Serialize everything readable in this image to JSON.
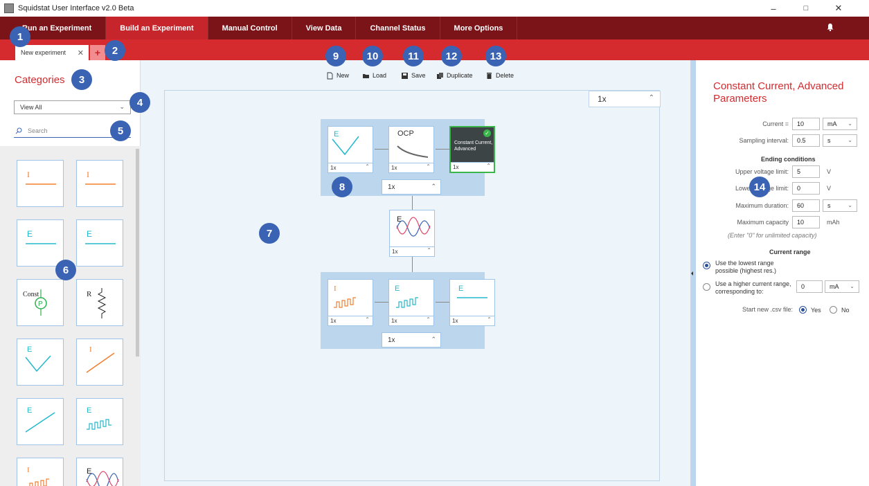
{
  "window": {
    "title": "Squidstat User Interface v2.0 Beta",
    "controls": [
      "–",
      "□",
      "✕"
    ]
  },
  "nav": {
    "tabs": [
      {
        "label": "Run an Experiment",
        "active": false
      },
      {
        "label": "Build an Experiment",
        "active": true
      },
      {
        "label": "Manual Control",
        "active": false
      },
      {
        "label": "View Data",
        "active": false
      },
      {
        "label": "Channel Status",
        "active": false
      },
      {
        "label": "More Options",
        "active": false
      }
    ],
    "bell_icon": "bell-icon"
  },
  "experiment_tabs": {
    "current": "New experiment",
    "close": "✕",
    "add": "+"
  },
  "callouts": [
    "1",
    "2",
    "3",
    "4",
    "5",
    "6",
    "7",
    "8",
    "9",
    "10",
    "11",
    "12",
    "13",
    "14"
  ],
  "categories": {
    "title": "Categories",
    "filter_value": "View All",
    "search_placeholder": "Search",
    "tiles": [
      {
        "label": "I",
        "color": "#f07f2f"
      },
      {
        "label": "I",
        "color": "#f07f2f"
      },
      {
        "label": "E",
        "color": "#22b8cc"
      },
      {
        "label": "E",
        "color": "#22b8cc"
      },
      {
        "label": "Const",
        "color": "#2bb24c"
      },
      {
        "label": "R",
        "color": "#222222"
      },
      {
        "label": "E",
        "color": "#22b8cc"
      },
      {
        "label": "I",
        "color": "#f07f2f"
      },
      {
        "label": "E",
        "color": "#22b8cc"
      },
      {
        "label": "E",
        "color": "#22b8cc"
      },
      {
        "label": "I",
        "color": "#f07f2f"
      },
      {
        "label": "E",
        "color": "#222222"
      }
    ]
  },
  "toolbar": {
    "new": "New",
    "load": "Load",
    "save": "Save",
    "duplicate": "Duplicate",
    "delete": "Delete"
  },
  "builder": {
    "total_repeats": "1x",
    "group1": {
      "steps": [
        {
          "label": "E",
          "repeats": "1x"
        },
        {
          "label": "OCP",
          "repeats": "1x"
        },
        {
          "label": "Constant Current, Advanced",
          "repeats": "1x"
        }
      ],
      "repeats": "1x"
    },
    "single": {
      "label": "E",
      "repeats": "1x"
    },
    "group2": {
      "steps": [
        {
          "label": "I",
          "repeats": "1x"
        },
        {
          "label": "E",
          "repeats": "1x"
        },
        {
          "label": "E",
          "repeats": "1x"
        }
      ],
      "repeats": "1x"
    }
  },
  "params": {
    "title": "Constant Current, Advanced Parameters",
    "current_label": "Current =",
    "current_value": "10",
    "current_unit": "mA",
    "sampling_label": "Sampling interval:",
    "sampling_value": "0.5",
    "sampling_unit": "s",
    "ending_head": "Ending conditions",
    "upper_label": "Upper voltage limit:",
    "upper_value": "5",
    "upper_unit": "V",
    "lower_label": "Lower voltage limit:",
    "lower_value": "0",
    "lower_unit": "V",
    "duration_label": "Maximum duration:",
    "duration_value": "60",
    "duration_unit": "s",
    "capacity_label": "Maximum capacity",
    "capacity_value": "10",
    "capacity_unit": "mAh",
    "capacity_note": "(Enter \"0\" for unlimited capacity)",
    "range_head": "Current range",
    "range_opt1": "Use the lowest range possible (highest res.)",
    "range_opt2": "Use a higher current range, corresponding to:",
    "range_value": "0",
    "range_unit": "mA",
    "csv_label": "Start new .csv file:",
    "csv_yes": "Yes",
    "csv_no": "No"
  }
}
